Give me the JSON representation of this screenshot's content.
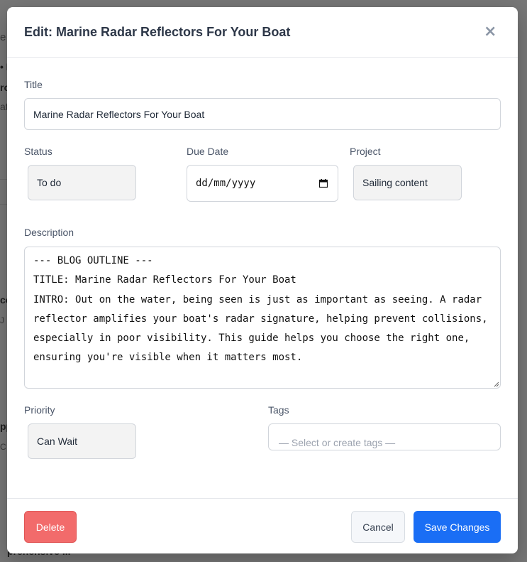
{
  "modal": {
    "title": "Edit: Marine Radar Reflectors For Your Boat",
    "close_glyph": "×"
  },
  "form": {
    "title_label": "Title",
    "title_value": "Marine Radar Reflectors For Your Boat",
    "status_label": "Status",
    "status_value": "To do",
    "due_date_label": "Due Date",
    "due_date_placeholder": "dd/mm/yyyy",
    "project_label": "Project",
    "project_value": "Sailing content",
    "description_label": "Description",
    "description_value": "--- BLOG OUTLINE ---\nTITLE: Marine Radar Reflectors For Your Boat\nINTRO: Out on the water, being seen is just as important as seeing. A radar reflector amplifies your boat's radar signature, helping prevent collisions, especially in poor visibility. This guide helps you choose the right one, ensuring you're visible when it matters most.",
    "priority_label": "Priority",
    "priority_value": "Can Wait",
    "tags_label": "Tags",
    "tags_placeholder": "— Select or create tags —"
  },
  "footer": {
    "delete_label": "Delete",
    "cancel_label": "Cancel",
    "save_label": "Save Changes"
  },
  "background": {
    "fragments": [
      "e",
      "• I",
      "ro",
      "at",
      "co",
      "J",
      "pp",
      "C",
      "prehensive ..."
    ]
  },
  "colors": {
    "primary": "#1a6ef5",
    "danger": "#f26b6b",
    "overlay": "#7a7a7a"
  },
  "icons": {
    "close": "close-icon",
    "calendar": "calendar-icon",
    "resize": "resize-grip-icon"
  }
}
